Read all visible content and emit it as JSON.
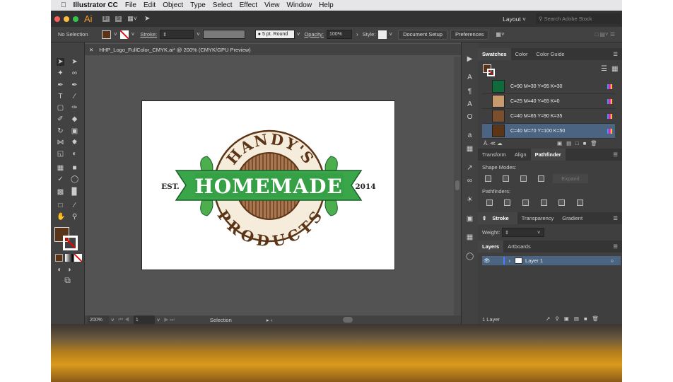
{
  "menubar": {
    "app": "Illustrator CC",
    "items": [
      "File",
      "Edit",
      "Object",
      "Type",
      "Select",
      "Effect",
      "View",
      "Window",
      "Help"
    ]
  },
  "titlebar": {
    "logo": "Ai",
    "bridge": "Br",
    "stock": "St",
    "workspace": "Layout",
    "search_placeholder": "Search Adobe Stock"
  },
  "control": {
    "selection": "No Selection",
    "stroke_label": "Stroke:",
    "brush": "5 pt. Round",
    "opacity_label": "Opacity:",
    "opacity": "100%",
    "style_label": "Style:",
    "document_setup": "Document Setup",
    "preferences": "Preferences",
    "fill_color": "#5a3418"
  },
  "document": {
    "tab": "HHP_Logo_FullColor_CMYK.ai* @ 200% (CMYK/GPU Preview)"
  },
  "logo": {
    "top": "HANDY'S",
    "banner": "HOMEMADE",
    "bottom": "PRODUCTS",
    "left": "EST.",
    "right": "2014"
  },
  "status": {
    "zoom": "200%",
    "page": "1",
    "tool": "Selection"
  },
  "swatches": {
    "tabs": [
      "Swatches",
      "Color",
      "Color Guide"
    ],
    "items": [
      {
        "name": "C=90 M=30 Y=95 K=30",
        "color": "#0e6b3c"
      },
      {
        "name": "C=25 M=40 Y=65 K=0",
        "color": "#c99a6b"
      },
      {
        "name": "C=40 M=65 Y=90 K=35",
        "color": "#7a4f30"
      },
      {
        "name": "C=40 M=70 Y=100 K=50",
        "color": "#5c3416"
      }
    ]
  },
  "pathfinder": {
    "tabs": [
      "Transform",
      "Align",
      "Pathfinder"
    ],
    "shape_modes": "Shape Modes:",
    "expand": "Expand",
    "pathfinders": "Pathfinders:"
  },
  "stroke": {
    "tabs": [
      "Stroke",
      "Transparency",
      "Gradient"
    ],
    "weight": "Weight:"
  },
  "layers": {
    "tabs": [
      "Layers",
      "Artboards"
    ],
    "layer": "Layer 1",
    "count": "1 Layer"
  }
}
